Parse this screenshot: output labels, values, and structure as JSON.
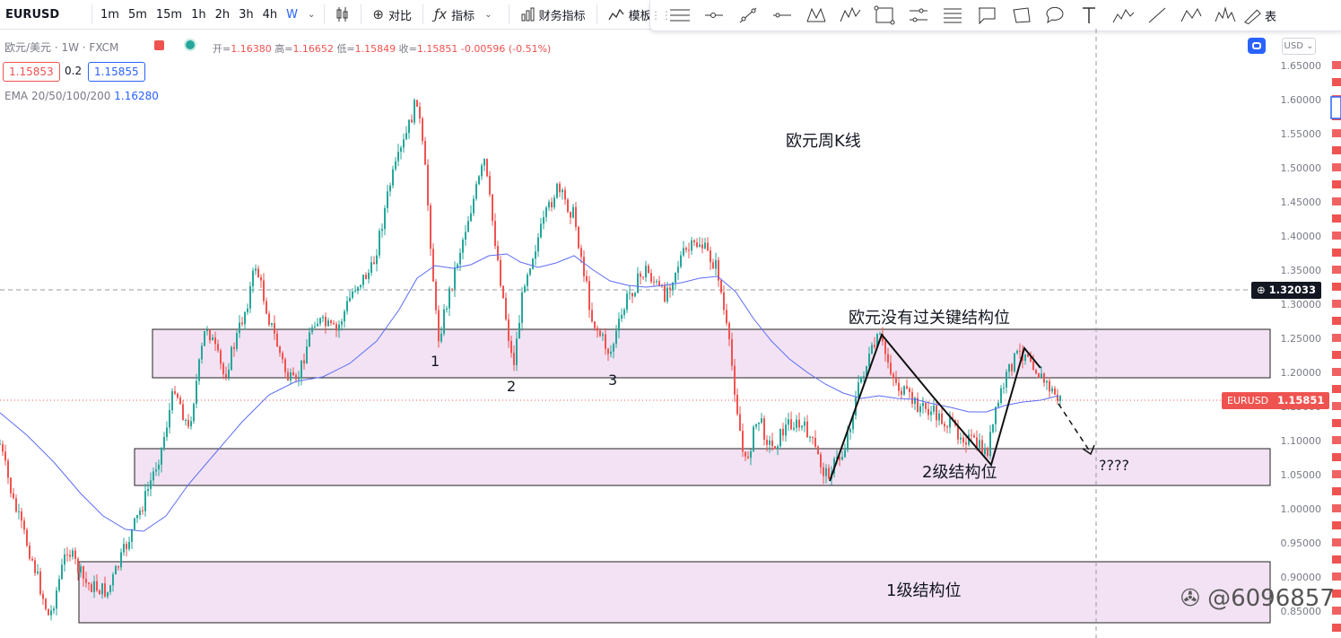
{
  "symbol": "EURUSD",
  "timeframes": [
    "1m",
    "5m",
    "15m",
    "1h",
    "2h",
    "3h",
    "4h",
    "W"
  ],
  "active_timeframe": "W",
  "toolbar": {
    "compare_label": "对比",
    "indicators_label": "指标",
    "financials_label": "财务指标",
    "templates_label": "模板"
  },
  "drawing_tools": [
    "horizontal-lines-icon",
    "horizontal-ray-icon",
    "trend-line-icon",
    "horizontal-line-icon",
    "xabcd-pattern-icon",
    "elliott-wave-icon",
    "rectangle-icon",
    "parallel-channel-icon",
    "fib-retracement-icon",
    "callout-icon",
    "polygon-icon",
    "comment-icon",
    "text-icon",
    "wave-12345-icon",
    "line-icon",
    "abcd-pattern-icon",
    "head-shoulders-icon",
    "brush-icon"
  ],
  "drawing_tools_last_label": "表",
  "legend": {
    "title": "欧元/美元 · 1W · FXCM",
    "ohlc": {
      "open_label": "开=",
      "open": "1.16380",
      "high_label": "高=",
      "high": "1.16652",
      "low_label": "低=",
      "low": "1.15849",
      "close_label": "收=",
      "close": "1.15851",
      "change": "-0.00596 (-0.51%)"
    },
    "bid": "1.15853",
    "spread": "0.2",
    "ask": "1.15855",
    "ema_label": "EMA 20/50/100/200",
    "ema_value": "1.16280"
  },
  "currency_button": "USD",
  "price_axis": [
    "1.65000",
    "1.60000",
    "1.55000",
    "1.50000",
    "1.45000",
    "1.40000",
    "1.35000",
    "1.30000",
    "1.25000",
    "1.20000",
    "1.15000",
    "1.10000",
    "1.05000",
    "1.00000",
    "0.95000",
    "0.90000",
    "0.85000"
  ],
  "crosshair_price": "1.32033",
  "last_price_tag": {
    "symbol": "EURUSD",
    "price": "1.15851"
  },
  "annotations": {
    "weekly_title": "欧元周K线",
    "no_break": "欧元没有过关键结构位",
    "level2": "2级结构位",
    "level1": "1级结构位",
    "question": "????",
    "n1": "1",
    "n2": "2",
    "n3": "3"
  },
  "watermark": "@6096857",
  "colors": {
    "up": "#26a69a",
    "down": "#ef5350",
    "ema": "#2962ff",
    "zone_fill": "#f2e2f3",
    "accent": "#2962ff"
  }
}
